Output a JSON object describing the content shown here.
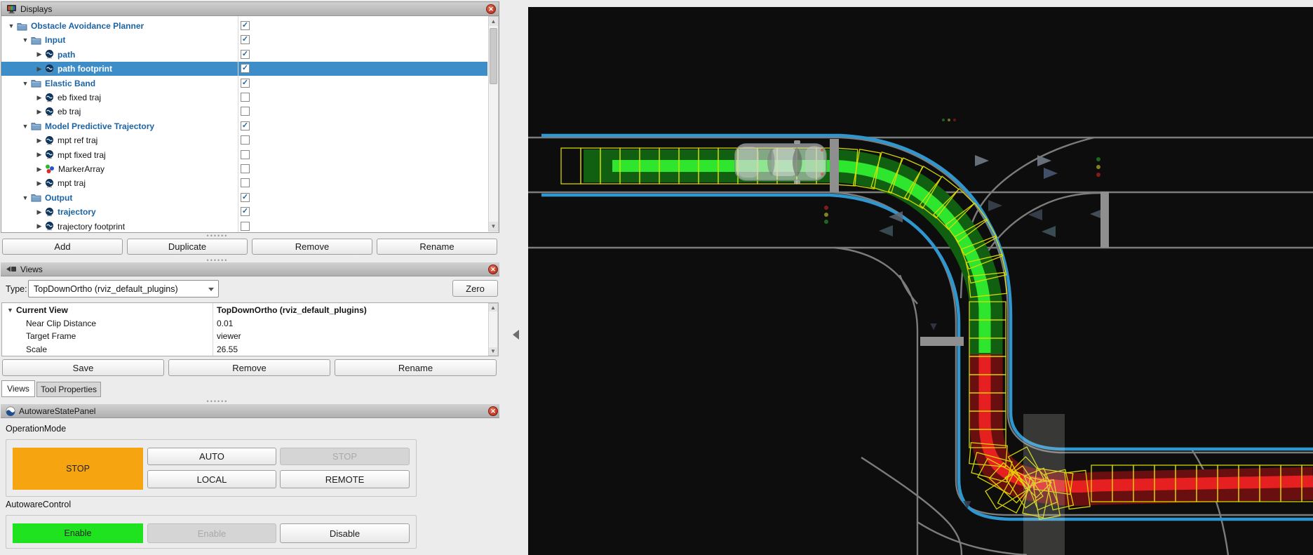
{
  "displays_panel": {
    "title": "Displays",
    "tree": [
      {
        "label": "Obstacle Avoidance Planner",
        "level": 0,
        "icon": "folder",
        "checked": true,
        "style": "blue",
        "expander": "expanded",
        "selected": false
      },
      {
        "label": "Input",
        "level": 1,
        "icon": "folder",
        "checked": true,
        "style": "blue",
        "expander": "expanded",
        "selected": false
      },
      {
        "label": "path",
        "level": 2,
        "icon": "topic",
        "checked": true,
        "style": "blue",
        "expander": "collapsed",
        "selected": false
      },
      {
        "label": "path footprint",
        "level": 2,
        "icon": "topic",
        "checked": true,
        "style": "blue",
        "expander": "collapsed",
        "selected": true
      },
      {
        "label": "Elastic Band",
        "level": 1,
        "icon": "folder",
        "checked": true,
        "style": "blue",
        "expander": "expanded",
        "selected": false
      },
      {
        "label": "eb fixed traj",
        "level": 2,
        "icon": "topic",
        "checked": false,
        "style": "plain",
        "expander": "collapsed",
        "selected": false
      },
      {
        "label": "eb traj",
        "level": 2,
        "icon": "topic",
        "checked": false,
        "style": "plain",
        "expander": "collapsed",
        "selected": false
      },
      {
        "label": "Model Predictive Trajectory",
        "level": 1,
        "icon": "folder",
        "checked": true,
        "style": "blue",
        "expander": "expanded",
        "selected": false
      },
      {
        "label": "mpt ref traj",
        "level": 2,
        "icon": "topic",
        "checked": false,
        "style": "plain",
        "expander": "collapsed",
        "selected": false
      },
      {
        "label": "mpt fixed traj",
        "level": 2,
        "icon": "topic",
        "checked": false,
        "style": "plain",
        "expander": "collapsed",
        "selected": false
      },
      {
        "label": "MarkerArray",
        "level": 2,
        "icon": "marker-array",
        "checked": false,
        "style": "plain",
        "expander": "collapsed",
        "selected": false
      },
      {
        "label": "mpt traj",
        "level": 2,
        "icon": "topic",
        "checked": false,
        "style": "plain",
        "expander": "collapsed",
        "selected": false
      },
      {
        "label": "Output",
        "level": 1,
        "icon": "folder",
        "checked": true,
        "style": "blue",
        "expander": "expanded",
        "selected": false
      },
      {
        "label": "trajectory",
        "level": 2,
        "icon": "topic",
        "checked": true,
        "style": "blue",
        "expander": "collapsed",
        "selected": false
      },
      {
        "label": "trajectory footprint",
        "level": 2,
        "icon": "topic",
        "checked": false,
        "style": "plain",
        "expander": "collapsed",
        "selected": false
      }
    ],
    "buttons": [
      "Add",
      "Duplicate",
      "Remove",
      "Rename"
    ]
  },
  "views_panel": {
    "title": "Views",
    "type_label": "Type:",
    "type_value": "TopDownOrtho (rviz_default_plugins)",
    "zero_button": "Zero",
    "properties": [
      {
        "name": "Current View",
        "value": "TopDownOrtho (rviz_default_plugins)"
      },
      {
        "name": "Near Clip Distance",
        "value": "0.01"
      },
      {
        "name": "Target Frame",
        "value": "viewer"
      },
      {
        "name": "Scale",
        "value": "26.55"
      }
    ],
    "buttons": [
      "Save",
      "Remove",
      "Rename"
    ],
    "tabs": [
      {
        "label": "Views",
        "active": true
      },
      {
        "label": "Tool Properties",
        "active": false
      }
    ]
  },
  "autoware_panel": {
    "title": "AutowareStatePanel",
    "operation_mode": {
      "label": "OperationMode",
      "state_button": {
        "label": "STOP",
        "color": "#f7a411"
      },
      "buttons": [
        {
          "label": "AUTO",
          "enabled": true
        },
        {
          "label": "STOP",
          "enabled": false
        },
        {
          "label": "LOCAL",
          "enabled": true
        },
        {
          "label": "REMOTE",
          "enabled": true
        }
      ]
    },
    "autoware_control": {
      "label": "AutowareControl",
      "state_button": {
        "label": "Enable",
        "color": "#20e320"
      },
      "buttons": [
        {
          "label": "Enable",
          "enabled": false
        },
        {
          "label": "Disable",
          "enabled": true
        }
      ]
    }
  },
  "viz": {
    "background": "#0d0d0d",
    "colors": {
      "lane_boundary_blue": "#2f97d0",
      "map_line_gray": "#7c7c7c",
      "path_green_bright": "#2ee62e",
      "path_green_dark": "#116011",
      "trajectory_red_bright": "#e62020",
      "trajectory_red_dark": "#6a0f0f",
      "footprint_yellow": "#e0e000",
      "stop_bar_gray": "#8f8f8f"
    }
  }
}
